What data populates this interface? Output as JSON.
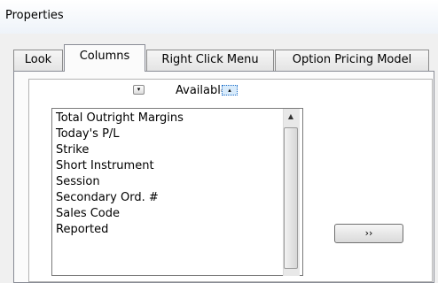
{
  "window": {
    "title": "Properties"
  },
  "tabs": [
    {
      "label": "Look",
      "active": false
    },
    {
      "label": "Columns",
      "active": true
    },
    {
      "label": "Right Click Menu",
      "active": false
    },
    {
      "label": "Option Pricing Model",
      "active": false
    }
  ],
  "available": {
    "label": "Available",
    "items": [
      "Total Outright Margins",
      "Today's P/L",
      "Strike",
      "Short Instrument",
      "Session",
      "Secondary Ord. #",
      "Sales Code",
      "Reported"
    ]
  },
  "buttons": {
    "move_right": "››"
  },
  "icons": {
    "sort_down": "▾",
    "sort_up": "▴",
    "scroll_up": "▲"
  },
  "colors": {
    "background": "#f0f0f0",
    "panel": "#fbfbfb",
    "focus": "#1e6ec8"
  }
}
